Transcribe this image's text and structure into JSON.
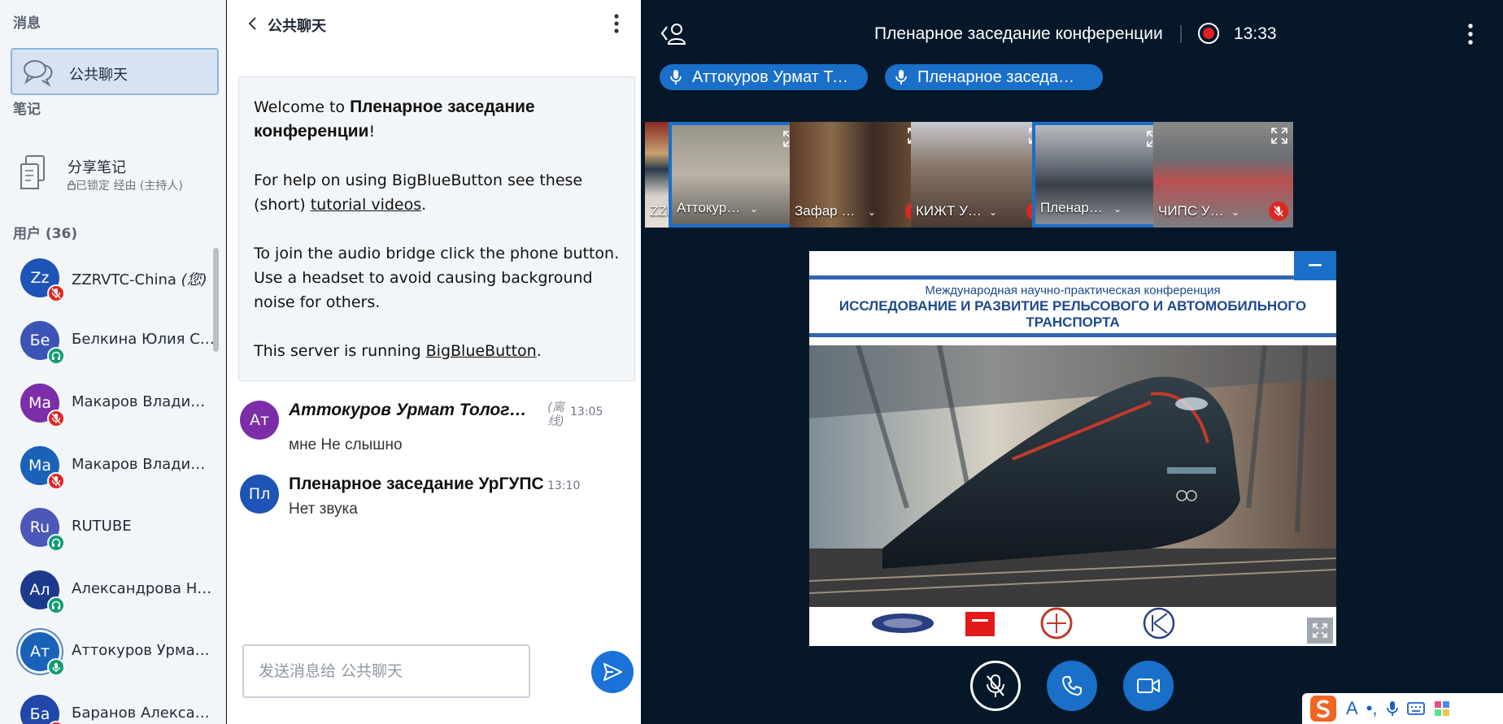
{
  "sidebar": {
    "messages_title": "消息",
    "public_chat": "公共聊天",
    "notes_title": "笔记",
    "shared_notes": "分享笔记",
    "notes_locked": "已锁定 经由 (主持人)",
    "users_title": "用户 (36)",
    "users": [
      {
        "initials": "Zz",
        "name": "ZZRVTC-China",
        "you": "(您)",
        "color": "#1e54b5",
        "status": "muted"
      },
      {
        "initials": "Бе",
        "name": "Белкина Юлия Се…",
        "you": "",
        "color": "#3b54b6",
        "status": "listen"
      },
      {
        "initials": "Ма",
        "name": "Макаров Владим…",
        "you": "",
        "color": "#7b2ea8",
        "status": "muted"
      },
      {
        "initials": "Ма",
        "name": "Макаров Владим…",
        "you": "",
        "color": "#1a62b8",
        "status": "muted"
      },
      {
        "initials": "Ru",
        "name": "RUTUBE",
        "you": "",
        "color": "#4a58b8",
        "status": "listen"
      },
      {
        "initials": "Ал",
        "name": "Александрова На…",
        "you": "",
        "color": "#1b3a8c",
        "status": "listen"
      },
      {
        "initials": "Ат",
        "name": "Аттокуров Урмат …",
        "you": "",
        "color": "#1a62b8",
        "status": "talking"
      },
      {
        "initials": "Ба",
        "name": "Баранов Алексан…",
        "you": "",
        "color": "#2148a8",
        "status": "muted"
      }
    ]
  },
  "chat": {
    "header_title": "公共聊天",
    "welcome": {
      "line1_prefix": "Welcome to ",
      "line1_strong": "Пленарное заседание конференции",
      "line1_suffix": "!",
      "help_prefix": "For help on using BigBlueButton see these (short) ",
      "help_link": "tutorial videos",
      "help_suffix": ".",
      "audio": "To join the audio bridge click the phone button. Use a headset to avoid causing background noise for others.",
      "server_prefix": "This server is running ",
      "server_link": "BigBlueButton",
      "server_suffix": "."
    },
    "messages": [
      {
        "initials": "Ат",
        "color": "#7b2ea8",
        "author": "Аттокуров Урмат Толог…",
        "offline": "(离线)",
        "time": "13:05",
        "text": "мне Не слышно"
      },
      {
        "initials": "Пл",
        "color": "#1e54b5",
        "author": "Пленарное заседание УрГУПС",
        "offline": "",
        "time": "13:10",
        "text": "Нет звука"
      }
    ],
    "input_placeholder": "发送消息给 公共聊天"
  },
  "meeting": {
    "title": "Пленарное заседание конференции",
    "time": "13:33",
    "talkers": [
      "Аттокуров Урмат То…",
      "Пленарное заседа…"
    ],
    "tiles": [
      {
        "name": "ZZRVTC-…",
        "muted": true,
        "active": false
      },
      {
        "name": "Аттокур…",
        "muted": false,
        "active": true
      },
      {
        "name": "Зафар …",
        "muted": true,
        "active": false
      },
      {
        "name": "КИЖТ У…",
        "muted": true,
        "active": false
      },
      {
        "name": "Пленар…",
        "muted": false,
        "active": true
      },
      {
        "name": "ЧИПС У…",
        "muted": true,
        "active": false
      }
    ],
    "slide": {
      "subtitle": "Международная научно-практическая конференция",
      "heading": "ИССЛЕДОВАНИЕ И РАЗВИТИЕ РЕЛЬСОВОГО И АВТОМОБИЛЬНОГО ТРАНСПОРТА"
    }
  },
  "colors": {
    "accent": "#1a6fc9",
    "muted_red": "#df2721",
    "listen_green": "#129a75",
    "meeting_bg": "#06172a"
  }
}
